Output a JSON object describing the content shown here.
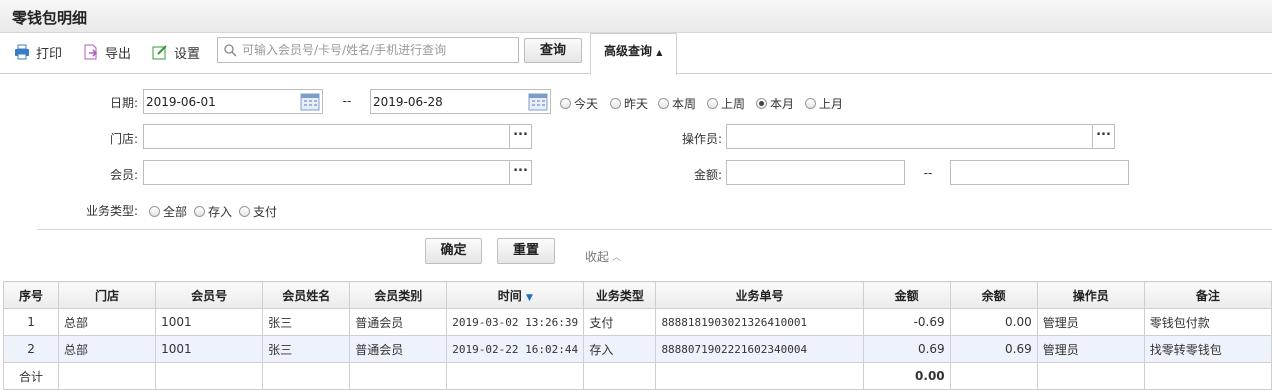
{
  "window": {
    "title": "零钱包明细"
  },
  "toolbar": {
    "print": "打印",
    "export": "导出",
    "settings": "设置",
    "search_placeholder": "可输入会员号/卡号/姓名/手机进行查询",
    "search_value": "",
    "query_button": "查询",
    "advanced_tab": "高级查询"
  },
  "filters": {
    "date_label": "日期:",
    "date_from": "2019-06-01",
    "date_sep": "--",
    "date_to": "2019-06-28",
    "date_presets": [
      "今天",
      "昨天",
      "本周",
      "上周",
      "本月",
      "上月"
    ],
    "date_selected": "本月",
    "store_label": "门店:",
    "store_value": "",
    "operator_label": "操作员:",
    "operator_value": "",
    "member_label": "会员:",
    "member_value": "",
    "amount_label": "金额:",
    "amount_from": "",
    "amount_sep": "--",
    "amount_to": "",
    "business_type_label": "业务类型:",
    "business_types": [
      "全部",
      "存入",
      "支付"
    ],
    "confirm_button": "确定",
    "reset_button": "重置",
    "collapse_link": "收起"
  },
  "table": {
    "columns": [
      "序号",
      "门店",
      "会员号",
      "会员姓名",
      "会员类别",
      "时间",
      "业务类型",
      "业务单号",
      "金额",
      "余额",
      "操作员",
      "备注"
    ],
    "sorted_column": "时间",
    "rows": [
      [
        "1",
        "总部",
        "1001",
        "张三",
        "普通会员",
        "2019-03-02 13:26:39",
        "支付",
        "8888181903021326410001",
        "-0.69",
        "0.00",
        "管理员",
        "零钱包付款"
      ],
      [
        "2",
        "总部",
        "1001",
        "张三",
        "普通会员",
        "2019-02-22 16:02:44",
        "存入",
        "8888071902221602340004",
        "0.69",
        "0.69",
        "管理员",
        "找零转零钱包"
      ]
    ],
    "total_label": "合计",
    "total_amount": "0.00"
  },
  "colors": {
    "accent": "#2a6ebb",
    "row_alt": "#eef2fb"
  }
}
